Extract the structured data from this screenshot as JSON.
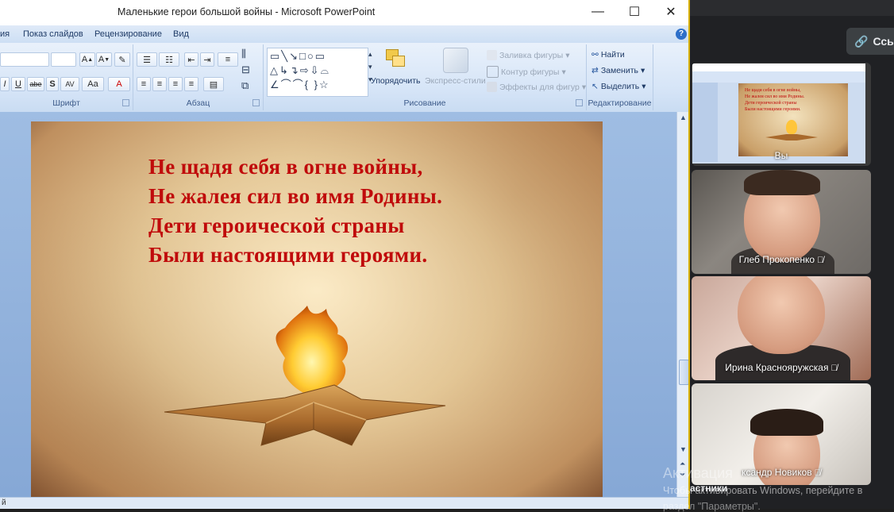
{
  "window": {
    "title": "Маленькие герои большой войны - Microsoft PowerPoint",
    "minimize": "—",
    "maximize": "☐",
    "close": "✕"
  },
  "menu": {
    "tabs": [
      "ия",
      "Показ слайдов",
      "Рецензирование",
      "Вид"
    ],
    "help": "?"
  },
  "ribbon": {
    "groups": {
      "font": "Шрифт",
      "paragraph": "Абзац",
      "drawing": "Рисование",
      "editing": "Редактирование"
    },
    "font_buttons": [
      "I",
      "U",
      "abe",
      "S",
      "AV",
      "Aa",
      "A"
    ],
    "arrange": "Упорядочить",
    "quick_styles": "Экспресс-стили",
    "shape_fill": "Заливка фигуры",
    "shape_outline": "Контур фигуры",
    "shape_effects": "Эффекты для фигур",
    "find": "Найти",
    "replace": "Заменить",
    "select": "Выделить"
  },
  "slide": {
    "lines": [
      "Не щадя себя в огне войны,",
      "Не жалея сил во имя Родины.",
      "Дети героической страны",
      "Были настоящими героями."
    ]
  },
  "status": {
    "text": "й"
  },
  "meeting": {
    "link_button": "Ссыл",
    "self_label": "Вы",
    "participants": [
      {
        "name": "Глеб Прокопенко"
      },
      {
        "name": "Ирина Краснояружская"
      },
      {
        "name": "ксандр Новиков"
      }
    ],
    "participants_label": "астники"
  },
  "watermark": {
    "title": "Активация",
    "line1": "Чтобы активировать Windows, перейдите в",
    "line2": "раздел \"Параметры\"."
  },
  "colors": {
    "slide_text": "#c00b0b",
    "ribbon_bg": "#d5e4f7",
    "meeting_bg": "#202124"
  },
  "icons": [
    "link-icon",
    "mic-off-icon",
    "binoculars-icon",
    "replace-icon",
    "select-icon",
    "help-icon"
  ]
}
